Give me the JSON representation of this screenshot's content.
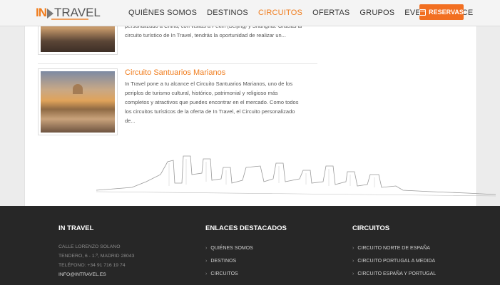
{
  "brand": {
    "logo_text": "TRAVEL",
    "logo_prefix": "IN"
  },
  "nav": {
    "items": [
      "QUIÉNES SOMOS",
      "DESTINOS",
      "CIRCUITOS",
      "OFERTAS",
      "GRUPOS",
      "EVENTOS",
      "MICE"
    ],
    "active": "CIRCUITOS",
    "reservas": "RESERVAS"
  },
  "posts": [
    {
      "title": "",
      "lines": [
        "personalizado a China, con visitas a Pekín (Beijing) y Shanghái. Gracias al",
        "circuito turístico de In Travel, tendrás la oportunidad de realizar un..."
      ]
    },
    {
      "title": "Circuito Santuarios Marianos",
      "lines": [
        "In Travel pone a tu alcance el Circuito Santuarios Marianos, uno de los",
        "periplos de turismo cultural, histórico, patrimonial y religioso más",
        "completos y atractivos que puedes encontrar en el mercado. Como todos",
        "los circuitos turísticos de la oferta de In Travel, el Circuito personalizado",
        "de..."
      ]
    }
  ],
  "footer": {
    "col1": {
      "heading": "IN TRAVEL",
      "address": [
        "CALLE LORENZO SOLANO",
        "TENDERO, 6 - 1.º, MADRID 28043",
        "TELÉFONO: +34 91 716 19 74"
      ],
      "email": "INFO@INTRAVEL.ES"
    },
    "col2": {
      "heading": "ENLACES DESTACADOS",
      "links": [
        "QUIÉNES SOMOS",
        "DESTINOS",
        "CIRCUITOS"
      ]
    },
    "col3": {
      "heading": "CIRCUITOS",
      "links": [
        "CIRCUITO NORTE DE ESPAÑA",
        "CIRCUITO PORTUGAL A MEDIDA",
        "CIRCUITO ESPAÑA Y PORTUGAL"
      ]
    }
  }
}
